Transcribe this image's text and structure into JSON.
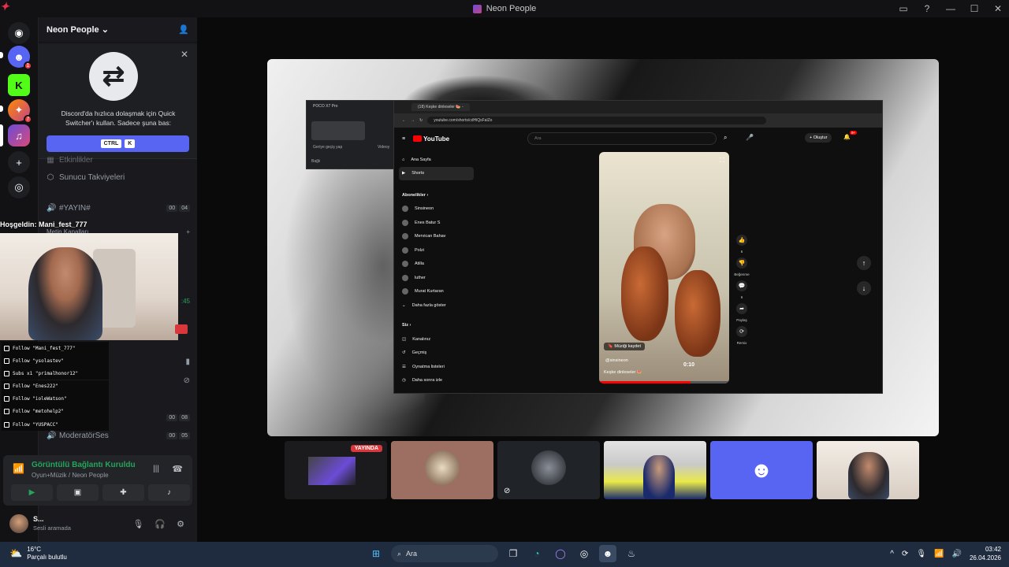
{
  "window": {
    "title": "Neon People"
  },
  "server": {
    "name": "Neon People",
    "name_chevron": "⌄"
  },
  "quick_switcher": {
    "text": "Discord'da hızlıca dolaşmak için Quick Switcher'ı kullan. Sadece şuna bas:",
    "key1": "CTRL",
    "key2": "K"
  },
  "guild_badges": {
    "first": "1",
    "second": "7"
  },
  "channels": {
    "etkinlikler": "Etkinlikler",
    "takviye": "Sunucu Takviyeleri",
    "yayin": "#YAYIN#",
    "yayin_c1": "00",
    "yayin_c2": "04",
    "metin": "Metin Kanalları",
    "ch2_c1": "00",
    "ch2_c2": "08",
    "moderator": "ModeratörSes",
    "mod_c1": "00",
    "mod_c2": "05",
    "time_partial": ":45"
  },
  "stream_overlay": {
    "welcome": "Hoşgeldin: Mani_fest_777",
    "events": [
      "Follow \"Mani_fest_777\"",
      "Follow \"ysolastev\"",
      "Subs x1 \"primalhonor12\"",
      "Follow \"Enes222\"",
      "Follow \"ioleWatson\"",
      "Follow \"metohelp2\"",
      "Follow \"YUSPACC\""
    ]
  },
  "voice": {
    "status": "Görüntülü Bağlantı Kuruldu",
    "subtitle": "Oyun+Müzik / Neon People"
  },
  "user": {
    "name": "S...",
    "status": "Sesli aramada"
  },
  "browser": {
    "tab_title": "(18) Keşke dinleseler 🍉 -",
    "url": "youtube.com/shorts/cdHiQsFalZo",
    "poco_title": "POCO X7 Pro",
    "poco_item1": "Geriye geçiş yap",
    "poco_item2": "Videoy",
    "poco_foot": "Bağlı"
  },
  "youtube": {
    "logo": "YouTube",
    "search_placeholder": "Ara",
    "create": "+ Oluştur",
    "notif_count": "9+",
    "nav": [
      "Ana Sayfa",
      "Shorts"
    ],
    "subs_header": "Abonelikler  ›",
    "subs": [
      "Sinsineon",
      "Enes Batur S",
      "Mervican Bahav",
      "Polzi",
      "Atilla",
      "luther",
      "Murat Kurtaran"
    ],
    "show_more": "Daha fazla göster",
    "you_header": "Siz  ›",
    "you_items": [
      "Kanalınız",
      "Geçmiş",
      "Oynatma listeleri",
      "Daha sonra izle"
    ],
    "short": {
      "chip": "Müziği kaydet",
      "user": "@sinsineon",
      "caption": "Keşke dinleseler 🍉",
      "time": "0:10"
    },
    "actions": [
      {
        "icon": "👍",
        "label": "6"
      },
      {
        "icon": "👎",
        "label": "Beğenme"
      },
      {
        "icon": "💬",
        "label": "6"
      },
      {
        "icon": "➦",
        "label": "Paylaş"
      },
      {
        "icon": "⟳",
        "label": "Remix"
      }
    ]
  },
  "thumbs": {
    "live_label": "YAYINDA"
  },
  "taskbar": {
    "temp": "16°C",
    "weather": "Parçalı bulutlu",
    "search": "Ara",
    "time": "03:42",
    "date": "26.04.2026"
  },
  "colors": {
    "discord_blurple": "#5865f2",
    "live_red": "#da373c",
    "connected_green": "#23a55a"
  }
}
